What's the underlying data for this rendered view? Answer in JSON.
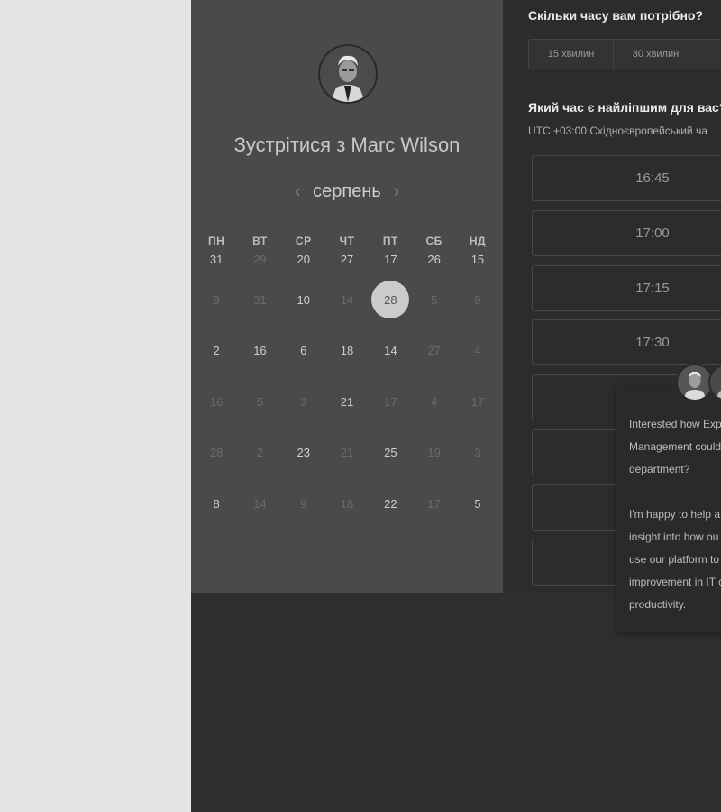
{
  "host": {
    "title": "Зустрітися з Marc Wilson",
    "avatar_icon": "person-portrait-icon"
  },
  "calendar": {
    "month": "серпень",
    "prev_icon": "‹",
    "next_icon": "›",
    "weekdays": [
      "ПН",
      "ВТ",
      "СР",
      "ЧТ",
      "ПТ",
      "СБ",
      "НД"
    ],
    "days": [
      "31",
      "29",
      "20",
      "27",
      "17",
      "26",
      "15",
      "9",
      "31",
      "10",
      "14",
      "28",
      "5",
      "9",
      "2",
      "16",
      "6",
      "18",
      "14",
      "27",
      "4",
      "16",
      "5",
      "3",
      "21",
      "17",
      "4",
      "17",
      "28",
      "2",
      "23",
      "21",
      "25",
      "19",
      "3",
      "8",
      "14",
      "9",
      "18",
      "22",
      "17",
      "5"
    ],
    "dim_indices": [
      1,
      7,
      8,
      10,
      12,
      13,
      19,
      20,
      21,
      22,
      23,
      25,
      26,
      27,
      28,
      29,
      31,
      33,
      34,
      36,
      37,
      38,
      40
    ],
    "selected_index": 11
  },
  "duration": {
    "heading": "Скільки часу вам потрібно?",
    "options": [
      "15 хвилин",
      "30 хвилин",
      ""
    ]
  },
  "time": {
    "heading": "Який час є найліпшим для вас?",
    "timezone": "UTC +03:00 Східноєвропейський ча",
    "slots": [
      "16:45",
      "17:00",
      "17:15",
      "17:30",
      "",
      "",
      "",
      ""
    ]
  },
  "chat": {
    "paragraphs": [
      [
        "Interested how Exp",
        "Management could",
        "department?"
      ],
      [
        "I'm happy to help a",
        "insight into how ou",
        "use our platform to",
        "improvement in IT c",
        "productivity."
      ]
    ]
  },
  "colors": {
    "selected_day_bg": "#cbcbcb",
    "panel_left": "#4a4a4a",
    "panel_right": "#2c2c2c"
  }
}
